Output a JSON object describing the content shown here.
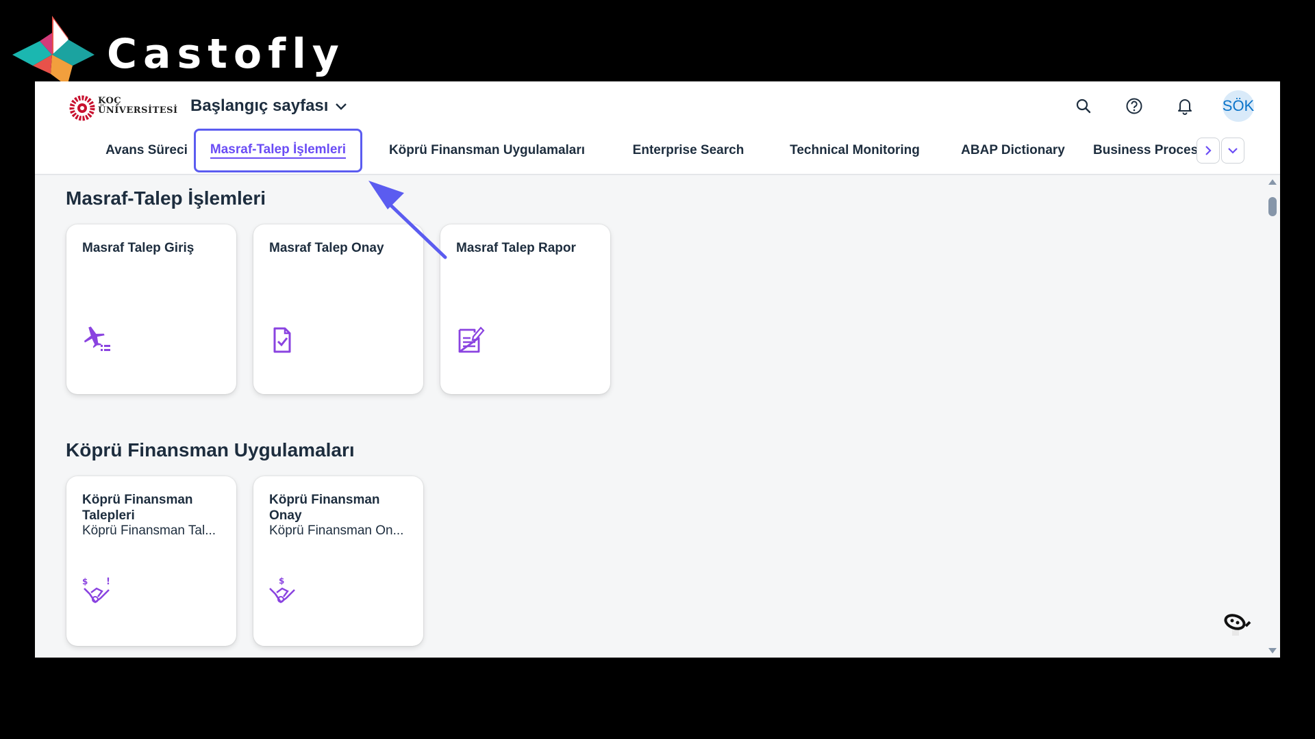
{
  "brand": {
    "name": "Castofly"
  },
  "shell": {
    "org_logo_line1": "KOÇ",
    "org_logo_line2": "ÜNİVERSİTESİ",
    "home_title": "Başlangıç sayfası",
    "avatar_initials": "SÖK"
  },
  "tabs": [
    {
      "label": "Avans Süreci"
    },
    {
      "label": "Masraf-Talep İşlemleri",
      "active": true
    },
    {
      "label": "Köprü Finansman Uygulamaları"
    },
    {
      "label": "Enterprise Search"
    },
    {
      "label": "Technical Monitoring"
    },
    {
      "label": "ABAP Dictionary"
    },
    {
      "label": "Business Proces"
    }
  ],
  "sections": [
    {
      "title": "Masraf-Talep İşlemleri",
      "tiles": [
        {
          "title": "Masraf Talep Giriş",
          "icon": "travel-expense-icon"
        },
        {
          "title": "Masraf Talep Onay",
          "icon": "document-check-icon"
        },
        {
          "title": "Masraf Talep Rapor",
          "icon": "report-edit-icon"
        }
      ]
    },
    {
      "title": "Köprü Finansman Uygulamaları",
      "tiles": [
        {
          "title": "Köprü Finansman Talepleri",
          "subtitle": "Köprü Finansman Tal...",
          "icon": "deal-alert-icon"
        },
        {
          "title": "Köprü Finansman Onay",
          "subtitle": "Köprü Finansman On...",
          "icon": "deal-icon"
        }
      ]
    }
  ],
  "colors": {
    "accent": "#6a4cf5",
    "tile_icon": "#8a43e0",
    "annotation_arrow": "#5b5cf0"
  }
}
